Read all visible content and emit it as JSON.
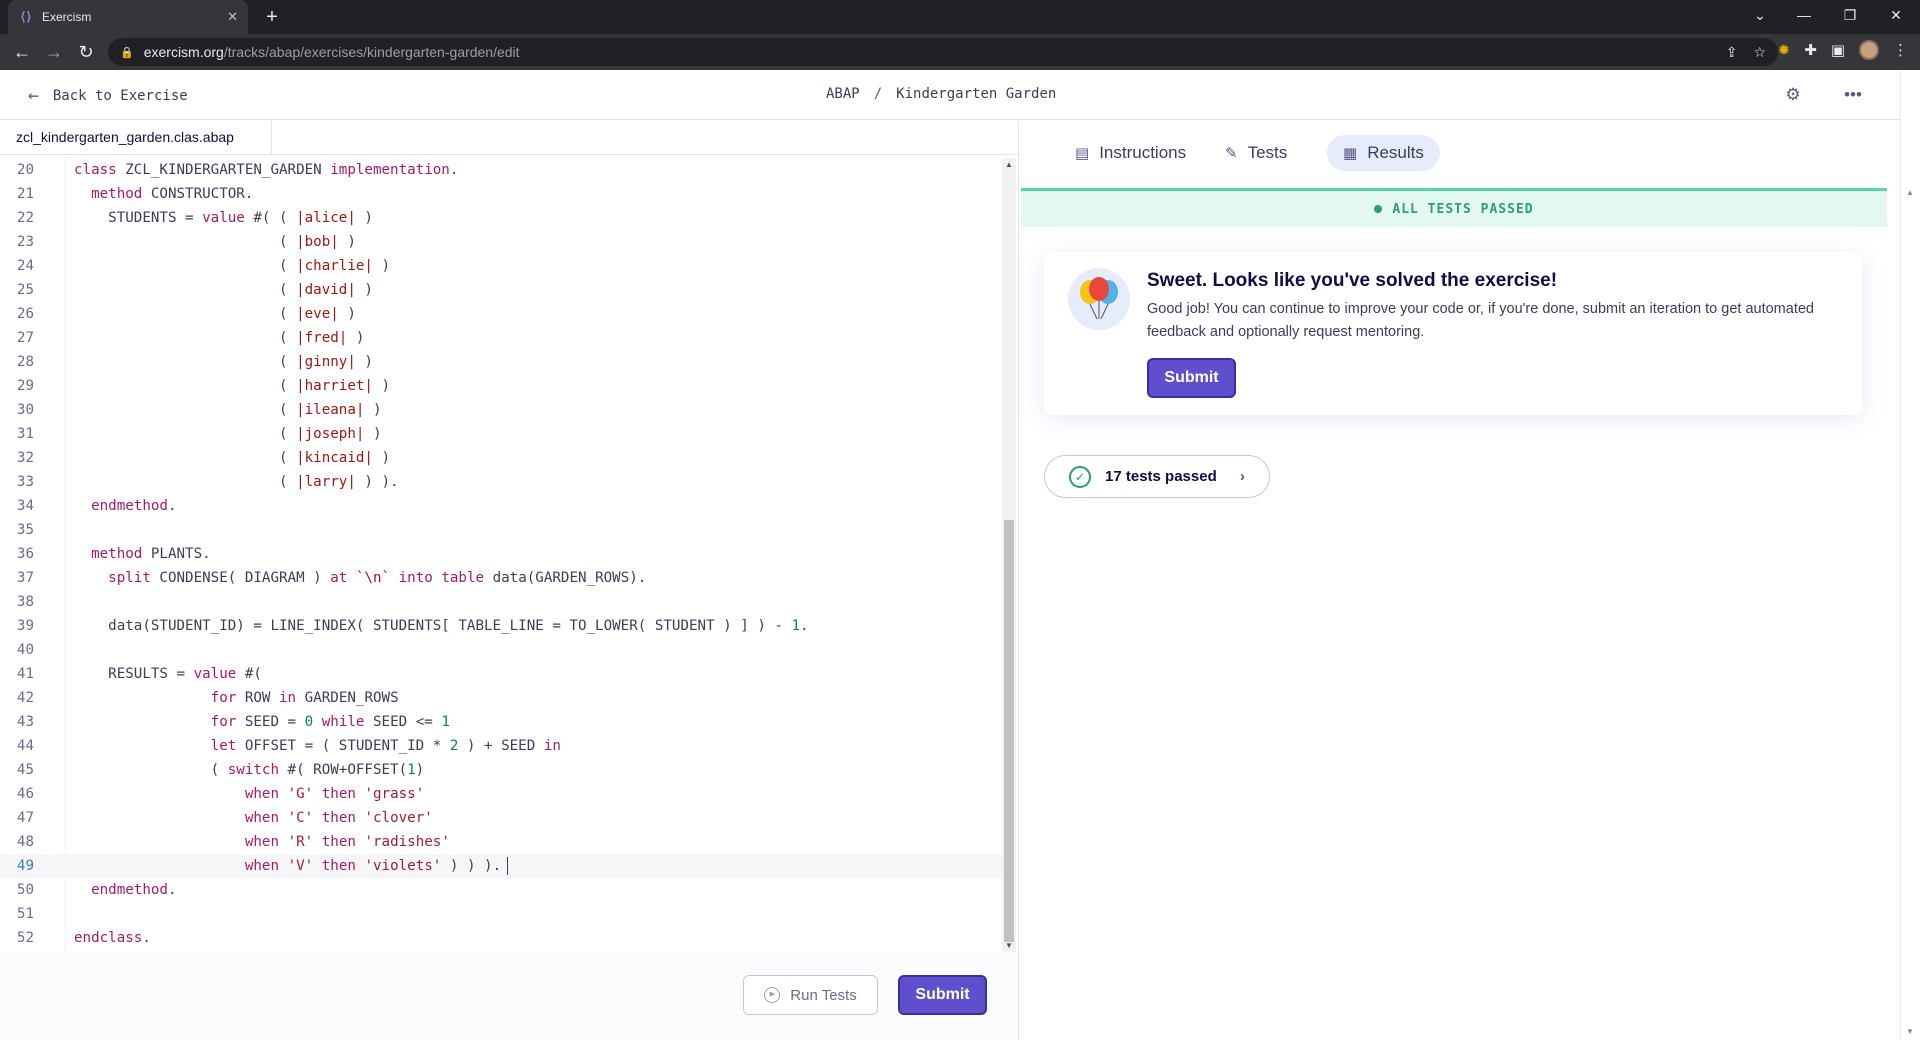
{
  "browser": {
    "tab_title": "Exercism",
    "url_host": "exercism.org",
    "url_path": "/tracks/abap/exercises/kindergarten-garden/edit"
  },
  "header": {
    "back_label": "Back to Exercise",
    "track": "ABAP",
    "separator": "/",
    "exercise": "Kindergarten Garden"
  },
  "editor": {
    "filename": "zcl_kindergarten_garden.clas.abap",
    "active_line": 49,
    "lines": [
      {
        "n": "20",
        "html": "<span class='k'>class</span> ZCL_KINDERGARTEN_GARDEN <span class='k'>implementation</span>."
      },
      {
        "n": "21",
        "html": "  <span class='k'>method</span> CONSTRUCTOR."
      },
      {
        "n": "22",
        "html": "    STUDENTS = <span class='k'>value</span> #( ( <span class='s'>|alice|</span> )"
      },
      {
        "n": "23",
        "html": "                        ( <span class='s'>|bob|</span> )"
      },
      {
        "n": "24",
        "html": "                        ( <span class='s'>|charlie|</span> )"
      },
      {
        "n": "25",
        "html": "                        ( <span class='s'>|david|</span> )"
      },
      {
        "n": "26",
        "html": "                        ( <span class='s'>|eve|</span> )"
      },
      {
        "n": "27",
        "html": "                        ( <span class='s'>|fred|</span> )"
      },
      {
        "n": "28",
        "html": "                        ( <span class='s'>|ginny|</span> )"
      },
      {
        "n": "29",
        "html": "                        ( <span class='s'>|harriet|</span> )"
      },
      {
        "n": "30",
        "html": "                        ( <span class='s'>|ileana|</span> )"
      },
      {
        "n": "31",
        "html": "                        ( <span class='s'>|joseph|</span> )"
      },
      {
        "n": "32",
        "html": "                        ( <span class='s'>|kincaid|</span> )"
      },
      {
        "n": "33",
        "html": "                        ( <span class='s'>|larry|</span> ) )."
      },
      {
        "n": "34",
        "html": "  <span class='k'>endmethod</span>."
      },
      {
        "n": "35",
        "html": ""
      },
      {
        "n": "36",
        "html": "  <span class='k'>method</span> PLANTS."
      },
      {
        "n": "37",
        "html": "    <span class='k'>split</span> CONDENSE( DIAGRAM ) <span class='k'>at</span> <span class='s'>`\\n`</span> <span class='k'>into table</span> data(GARDEN_ROWS)."
      },
      {
        "n": "38",
        "html": ""
      },
      {
        "n": "39",
        "html": "    data(STUDENT_ID) = LINE_INDEX( STUDENTS[ TABLE_LINE = TO_LOWER( STUDENT ) ] ) - <span class='n'>1</span>."
      },
      {
        "n": "40",
        "html": ""
      },
      {
        "n": "41",
        "html": "    RESULTS = <span class='k'>value</span> #("
      },
      {
        "n": "42",
        "html": "                <span class='k'>for</span> ROW <span class='k'>in</span> GARDEN_ROWS"
      },
      {
        "n": "43",
        "html": "                <span class='k'>for</span> SEED = <span class='n'>0</span> <span class='k'>while</span> SEED &lt;= <span class='n'>1</span>"
      },
      {
        "n": "44",
        "html": "                <span class='k'>let</span> OFFSET = ( STUDENT_ID * <span class='n'>2</span> ) + SEED <span class='k'>in</span>"
      },
      {
        "n": "45",
        "html": "                ( <span class='k'>switch</span> #( ROW+OFFSET(<span class='n'>1</span>)"
      },
      {
        "n": "46",
        "html": "                    <span class='k'>when</span> <span class='str'>'G'</span> <span class='k'>then</span> <span class='str'>'grass'</span>"
      },
      {
        "n": "47",
        "html": "                    <span class='k'>when</span> <span class='str'>'C'</span> <span class='k'>then</span> <span class='str'>'clover'</span>"
      },
      {
        "n": "48",
        "html": "                    <span class='k'>when</span> <span class='str'>'R'</span> <span class='k'>then</span> <span class='str'>'radishes'</span>"
      },
      {
        "n": "49",
        "html": "                    <span class='k'>when</span> <span class='str'>'V'</span> <span class='k'>then</span> <span class='str'>'violets'</span> ) ) )."
      },
      {
        "n": "50",
        "html": "  <span class='k'>endmethod</span>."
      },
      {
        "n": "51",
        "html": ""
      },
      {
        "n": "52",
        "html": "<span class='k'>endclass</span>."
      }
    ],
    "run_tests_label": "Run Tests",
    "submit_label": "Submit"
  },
  "results": {
    "tabs": [
      {
        "label": "Instructions",
        "icon": "instructions-icon"
      },
      {
        "label": "Tests",
        "icon": "tests-icon"
      },
      {
        "label": "Results",
        "icon": "results-icon"
      }
    ],
    "active_tab": "Results",
    "banner": "ALL TESTS PASSED",
    "card_title": "Sweet. Looks like you've solved the exercise!",
    "card_body": "Good job! You can continue to improve your code or, if you're done, submit an iteration to get automated feedback and optionally request mentoring.",
    "card_submit": "Submit",
    "tests_passed": "17 tests passed"
  },
  "colors": {
    "accent": "#604fcd",
    "success": "#2e9b7b",
    "success_bg": "#e3f8f1"
  }
}
